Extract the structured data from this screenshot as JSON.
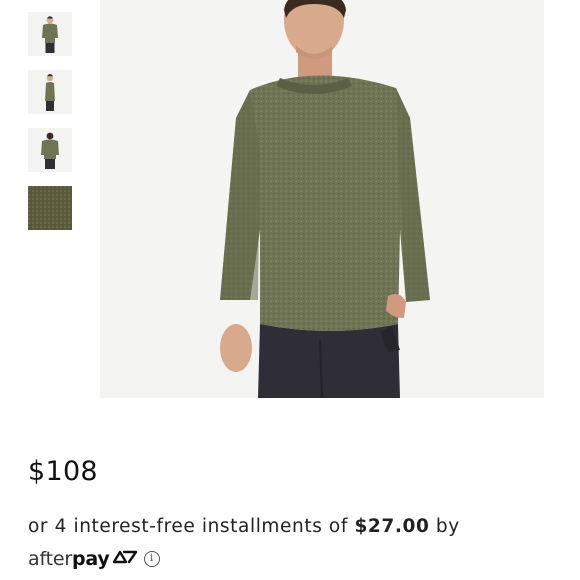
{
  "product": {
    "price": "$108",
    "installments": {
      "prefix": "or 4 interest-free installments of ",
      "amount": "$27.00",
      "suffix": " by"
    },
    "afterpay": {
      "logo_light": "after",
      "logo_bold": "pay",
      "info_symbol": "i"
    }
  },
  "gallery": {
    "thumbnails": [
      "front-view",
      "side-view",
      "back-view",
      "fabric-detail"
    ],
    "main_image": "model-wearing-olive-long-sleeve-tee"
  },
  "colors": {
    "garment": "#6f7454",
    "garment_shadow": "#5b6044",
    "pants": "#2f2d36",
    "background": "#f4f4f3",
    "skin": "#d9a98c",
    "hair": "#3a2a20"
  }
}
